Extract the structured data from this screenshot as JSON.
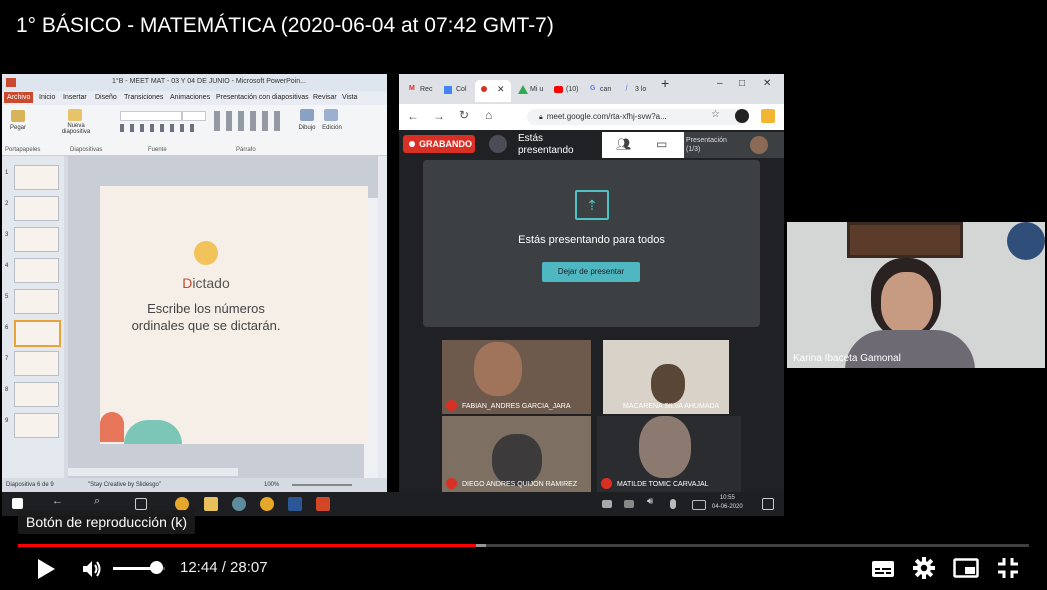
{
  "video": {
    "title": "1° BÁSICO - MATEMÁTICA (2020-06-04 at 07:42 GMT-7)"
  },
  "ppt": {
    "window_title": "1°B - MEET MAT - 03 Y 04 DE JUNIO - Microsoft PowerPoin...",
    "menu": [
      "Archivo",
      "Inicio",
      "Insertar",
      "Diseño",
      "Transiciones",
      "Animaciones",
      "Presentación con diapositivas",
      "Revisar",
      "Vista"
    ],
    "ribbon": {
      "paste": "Pegar",
      "new_slide": "Nueva diapositiva",
      "draw": "Dibujo",
      "edit": "Edición",
      "groups": [
        "Portapapeles",
        "Diapositivas",
        "Fuente",
        "Párrafo"
      ]
    },
    "slide_numbers": [
      "1",
      "2",
      "3",
      "4",
      "5",
      "6",
      "7",
      "8",
      "9"
    ],
    "selected_slide": 6,
    "slide": {
      "title_first": "D",
      "title_rest": "ictado",
      "subtitle_line1": "Escribe los números",
      "subtitle_line2": "ordinales que se dictarán."
    },
    "status": {
      "slide_count": "Diapositiva 6 de 9",
      "theme": "\"Stay Creative by Slidesgo\"",
      "zoom": "100%"
    }
  },
  "chrome": {
    "tabs": [
      "Rec",
      "Col",
      "",
      "Mi u",
      "(10)",
      "can",
      "3 lo"
    ],
    "url": "meet.google.com/rta-xfhj-svw?a...",
    "window_controls": [
      "–",
      "□",
      "✕"
    ]
  },
  "meet": {
    "recording_label": "GRABANDO",
    "presenting_line1": "Estás",
    "presenting_line2": "presentando",
    "presentation_tab": "Presentación",
    "presentation_count": "(1/3)",
    "presenting_to_all": "Estás presentando para todos",
    "stop_button": "Dejar de presentar",
    "participants": [
      "FABIAN_ANDRES GARCIA_JARA",
      "MACARENA SILVA AHUMADA",
      "DIEGO ANDRES QUIJON RAMIREZ",
      "MATILDE TOMIC CARVAJAL"
    ]
  },
  "webcam": {
    "name": "Karina Ibaceta Gamonal"
  },
  "taskbar": {
    "time": "10:55",
    "date": "04-06-2020"
  },
  "player": {
    "tooltip": "Botón de reproducción (k)",
    "time_display": "12:44 / 28:07",
    "played_fraction": 0.453,
    "buffered_fraction": 0.463,
    "volume_fraction": 0.82,
    "accent_color": "#ff0000"
  }
}
